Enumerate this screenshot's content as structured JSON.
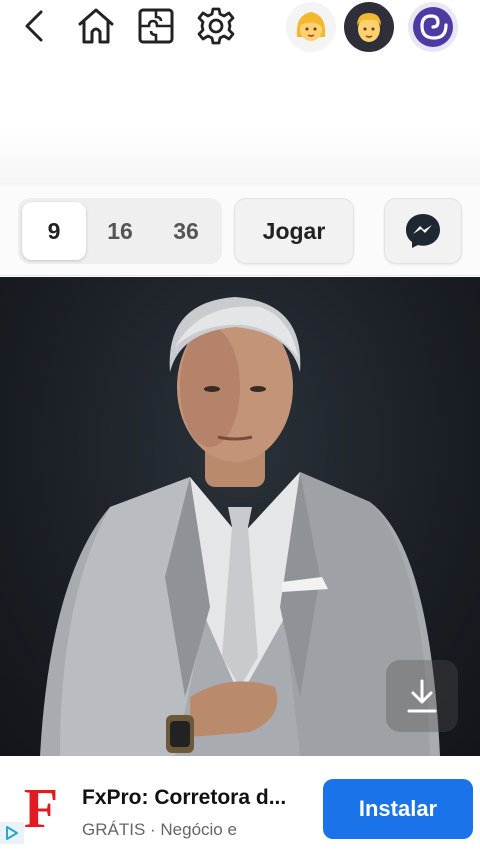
{
  "header": {
    "back_icon": "chevron-left-icon",
    "home_icon": "home-icon",
    "puzzle_icon": "puzzle-icon",
    "settings_icon": "gear-icon",
    "avatars": [
      {
        "name": "woman-avatar",
        "emoji": "👩"
      },
      {
        "name": "man-avatar",
        "emoji": "👨"
      },
      {
        "name": "spiral-avatar"
      }
    ]
  },
  "controls": {
    "piece_options": [
      "9",
      "16",
      "36"
    ],
    "selected_piece_option": "9",
    "play_label": "Jogar",
    "messenger_icon": "messenger-icon"
  },
  "image": {
    "subject": "puzzle-image",
    "download_icon": "download-icon"
  },
  "ad": {
    "logo_letter": "F",
    "title": "FxPro: Corretora d...",
    "subtitle": "GRÁTIS · Negócio e",
    "install_label": "Instalar",
    "accent_color": "#1a73e8",
    "logo_color": "#e01b22"
  }
}
